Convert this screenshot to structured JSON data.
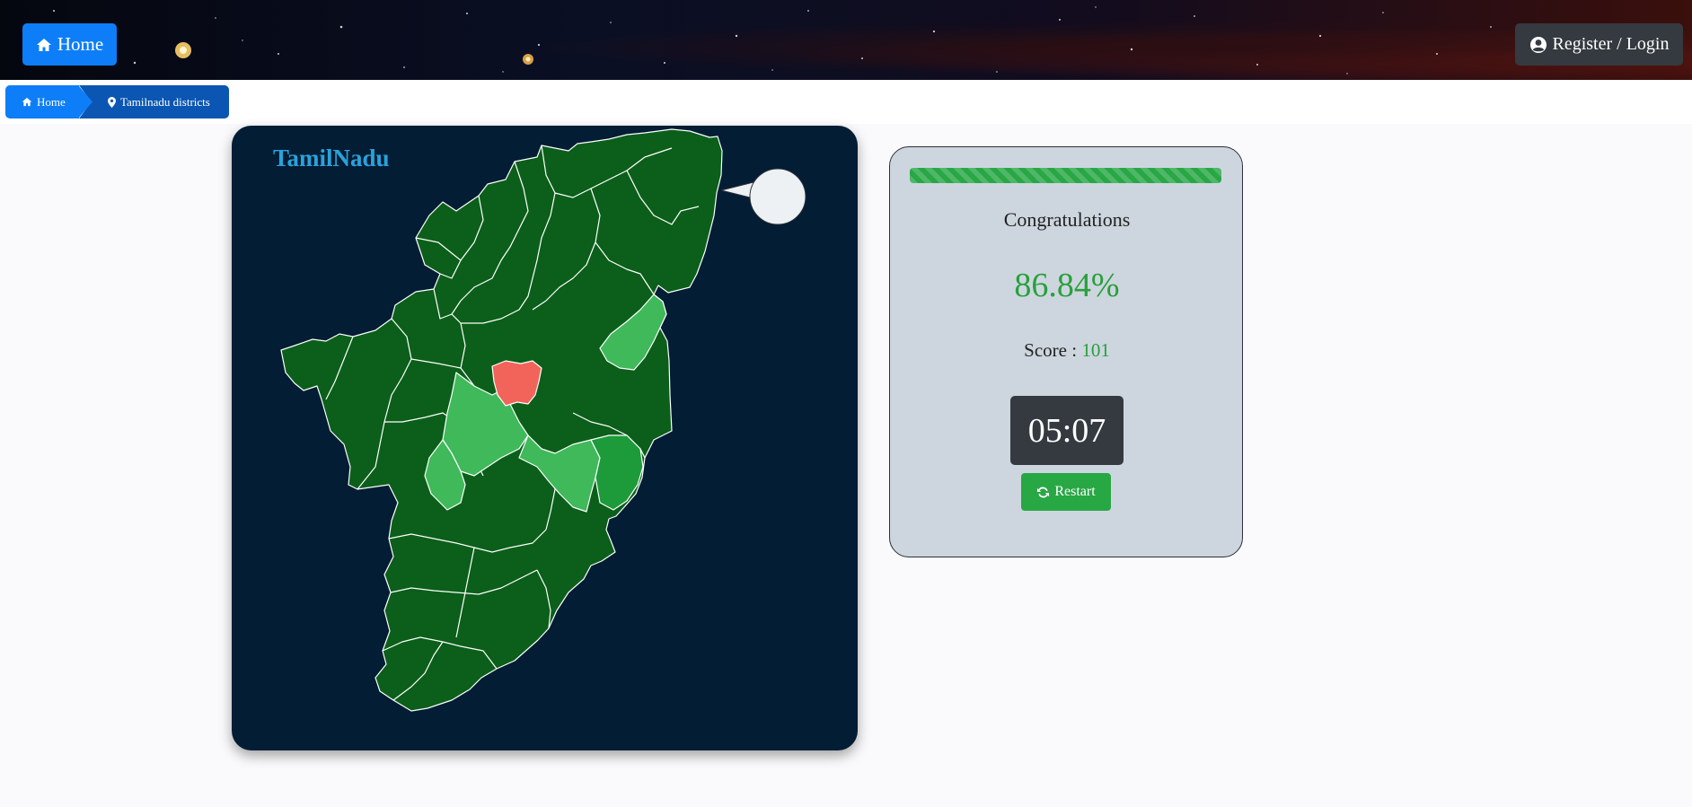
{
  "header": {
    "home_label": "Home",
    "login_label": "Register / Login"
  },
  "breadcrumb": {
    "home": "Home",
    "current": "Tamilnadu districts"
  },
  "map": {
    "title": "TamilNadu",
    "colors": {
      "background": "#031d34",
      "district_default": "#0b5f1a",
      "district_light": "#3fb95a",
      "district_mid": "#1d9a3a",
      "district_wrong": "#f2645a",
      "border": "#ffffff"
    }
  },
  "result": {
    "progress_fraction": 1.0,
    "message": "Congratulations",
    "percentage": "86.84%",
    "score_label": "Score :",
    "score_value": "101",
    "timer": "05:07",
    "restart_label": "Restart"
  },
  "icons": {
    "home": "home-icon",
    "user": "user-circle-icon",
    "marker": "map-marker-icon",
    "refresh": "refresh-icon"
  }
}
